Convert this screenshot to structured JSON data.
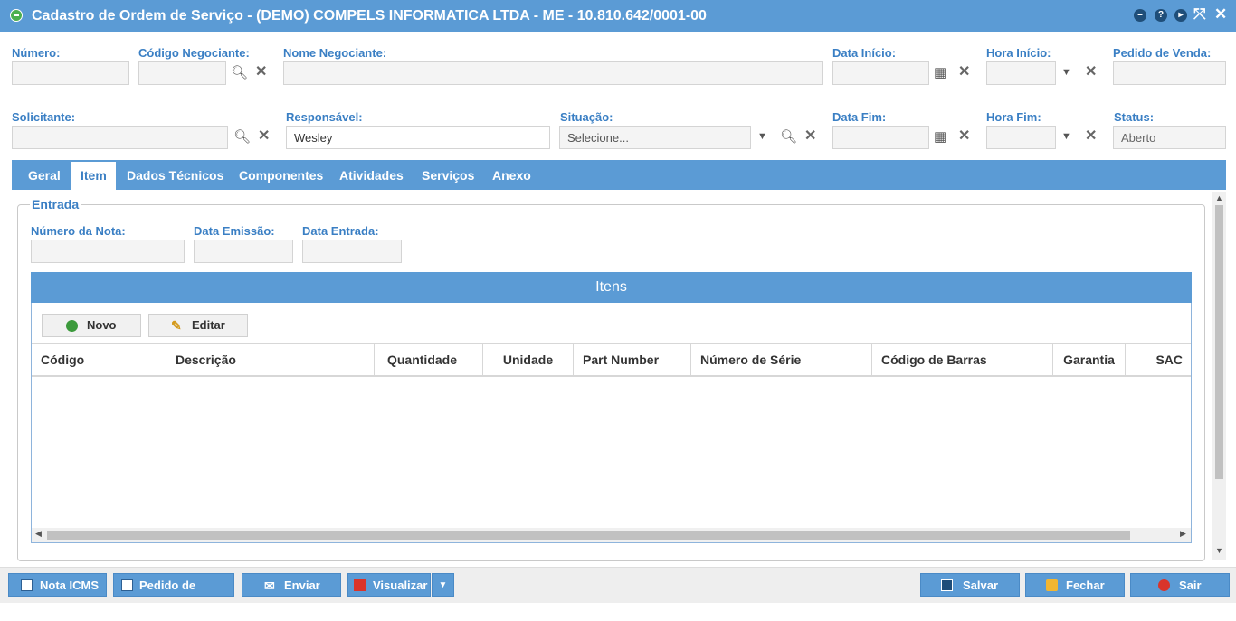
{
  "window": {
    "title": "Cadastro de Ordem de Serviço - (DEMO) COMPELS INFORMATICA LTDA - ME - 10.810.642/0001-00",
    "controls": [
      "minimize-icon",
      "help-icon",
      "play-icon",
      "collapse-icon",
      "close-icon"
    ]
  },
  "form": {
    "numero": {
      "label": "Número:",
      "value": ""
    },
    "codigo_negociante": {
      "label": "Código Negociante:",
      "value": ""
    },
    "nome_negociante": {
      "label": "Nome Negociante:",
      "value": ""
    },
    "data_inicio": {
      "label": "Data Início:",
      "value": ""
    },
    "hora_inicio": {
      "label": "Hora Início:",
      "value": ""
    },
    "pedido_venda": {
      "label": "Pedido de Venda:",
      "value": ""
    },
    "solicitante": {
      "label": "Solicitante:",
      "value": ""
    },
    "responsavel": {
      "label": "Responsável:",
      "value": "Wesley"
    },
    "situacao": {
      "label": "Situação:",
      "placeholder": "Selecione..."
    },
    "data_fim": {
      "label": "Data Fim:",
      "value": ""
    },
    "hora_fim": {
      "label": "Hora Fim:",
      "value": ""
    },
    "status": {
      "label": "Status:",
      "value": "Aberto"
    }
  },
  "tabs": [
    {
      "label": "Geral",
      "active": false
    },
    {
      "label": "Item",
      "active": true
    },
    {
      "label": "Dados Técnicos",
      "active": false
    },
    {
      "label": "Componentes",
      "active": false
    },
    {
      "label": "Atividades",
      "active": false
    },
    {
      "label": "Serviços",
      "active": false
    },
    {
      "label": "Anexo",
      "active": false
    }
  ],
  "entrada": {
    "legend": "Entrada",
    "numero_nota": {
      "label": "Número da Nota:",
      "value": ""
    },
    "data_emissao": {
      "label": "Data Emissão:",
      "value": ""
    },
    "data_entrada": {
      "label": "Data Entrada:",
      "value": ""
    }
  },
  "itens": {
    "title": "Itens",
    "novo_label": "Novo",
    "editar_label": "Editar",
    "columns": [
      "Código",
      "Descrição",
      "Quantidade",
      "Unidade",
      "Part Number",
      "Número de Série",
      "Código de Barras",
      "Garantia",
      "SAC"
    ],
    "rows": []
  },
  "footer": {
    "nota_icms": "Nota ICMS",
    "pedido_venda": "Pedido de Venda",
    "enviar": "Enviar",
    "visualizar": "Visualizar",
    "salvar": "Salvar",
    "fechar": "Fechar",
    "sair": "Sair"
  },
  "colors": {
    "accent": "#5b9bd5",
    "label": "#3a7fc4"
  }
}
